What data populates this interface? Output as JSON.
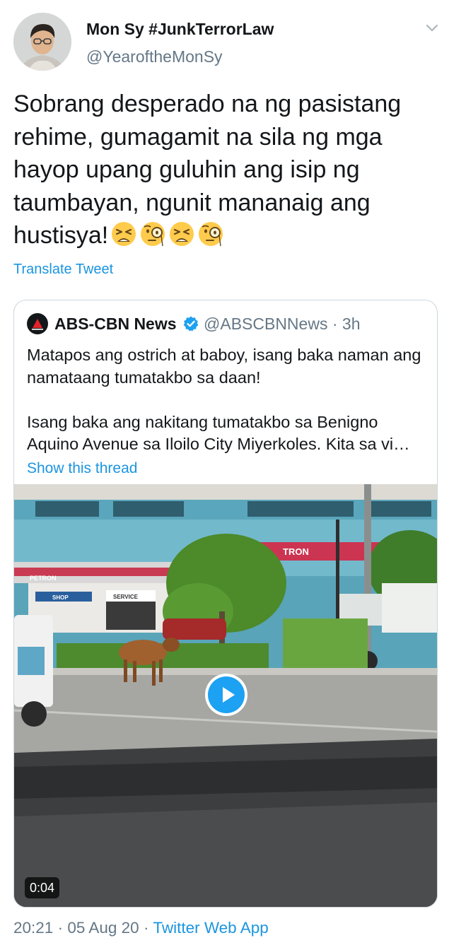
{
  "tweet": {
    "author": {
      "display_name": "Mon Sy #JunkTerrorLaw",
      "handle": "@YearoftheMonSy",
      "avatar_icon": "profile-photo"
    },
    "text": "Sobrang desperado na ng pasistang rehime, gumagamit na sila ng mga hayop upang guluhin ang isip ng taumbayan, ngunit mananaig ang hustisya!",
    "emojis": [
      "tired-face",
      "face-with-monocle",
      "tired-face",
      "face-with-monocle"
    ],
    "translate_label": "Translate Tweet",
    "menu_icon": "chevron-down-icon",
    "footer": {
      "time": "20:21",
      "date": "05 Aug 20",
      "separator": "·",
      "source": "Twitter Web App"
    }
  },
  "quoted_tweet": {
    "author": {
      "display_name": "ABS-CBN News",
      "handle": "@ABSCBNNews",
      "age": "3h",
      "verified": true,
      "logo_icon": "abs-cbn-news-logo"
    },
    "text_1": "Matapos ang ostrich at baboy, isang baka naman ang namataang tumatakbo sa daan!",
    "text_2": "Isang baka ang nakitang tumatakbo sa Benigno Aquino Avenue sa Iloilo City Miyerkoles. Kita sa vi…",
    "show_thread_label": "Show this thread",
    "video": {
      "duration": "0:04",
      "play_icon": "play-icon",
      "signage": {
        "petron": "PETRON",
        "petron_roof": "TRON",
        "shop": "SHOP",
        "service": "SERVICE"
      }
    }
  },
  "colors": {
    "link": "#1b95e0",
    "secondary_text": "#657786",
    "primary_text": "#14171a",
    "border": "#ccd6dd",
    "play_button": "#1da1f2",
    "verified": "#1da1f2"
  }
}
